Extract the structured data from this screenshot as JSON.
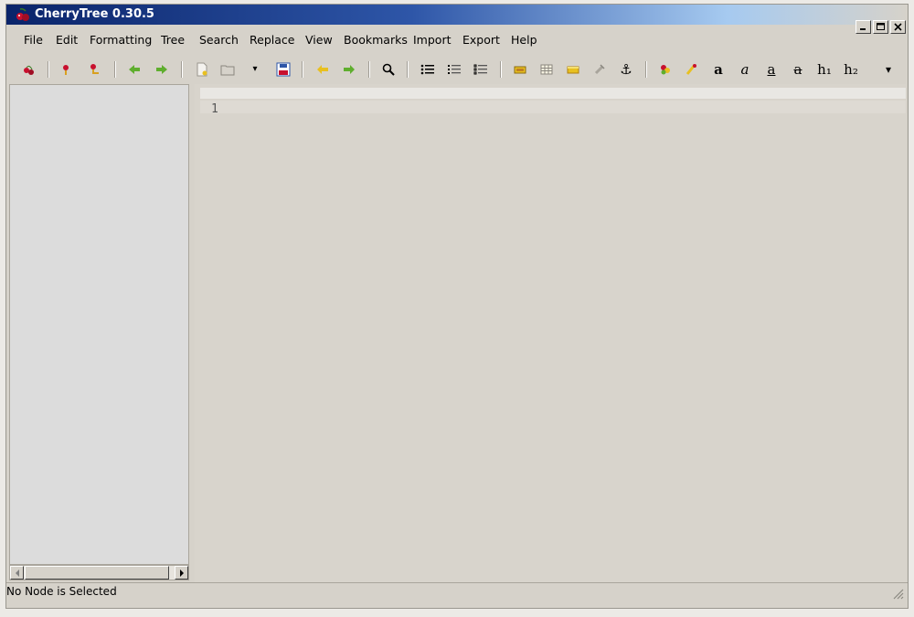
{
  "window": {
    "title": "CherryTree 0.30.5",
    "controls": {
      "minimize": "_",
      "maximize": "□",
      "close": "×"
    }
  },
  "menu": [
    {
      "label": "File"
    },
    {
      "label": "Edit"
    },
    {
      "label": "Formatting"
    },
    {
      "label": "Tree"
    },
    {
      "label": "Search"
    },
    {
      "label": "Replace"
    },
    {
      "label": "View"
    },
    {
      "label": "Bookmarks"
    },
    {
      "label": "Import"
    },
    {
      "label": "Export"
    },
    {
      "label": "Help"
    }
  ],
  "toolbar": {
    "bold_glyph": "a",
    "italic_glyph": "a",
    "underline_glyph": "a",
    "strike_glyph": "a",
    "h1_glyph": "h₁",
    "h2_glyph": "h₂",
    "more_glyph": "▾",
    "dropdown_glyph": "▾",
    "find_glyph": "🔍",
    "anchor_glyph": "⚓"
  },
  "editor": {
    "line_number": "1"
  },
  "status": {
    "text": "No Node is Selected"
  },
  "colors": {
    "title_start": "#0a246a",
    "title_end": "#a6caf0",
    "cherry_red": "#c8102e",
    "arrow_green": "#5fae2e",
    "arrow_yellow": "#e8c020"
  }
}
